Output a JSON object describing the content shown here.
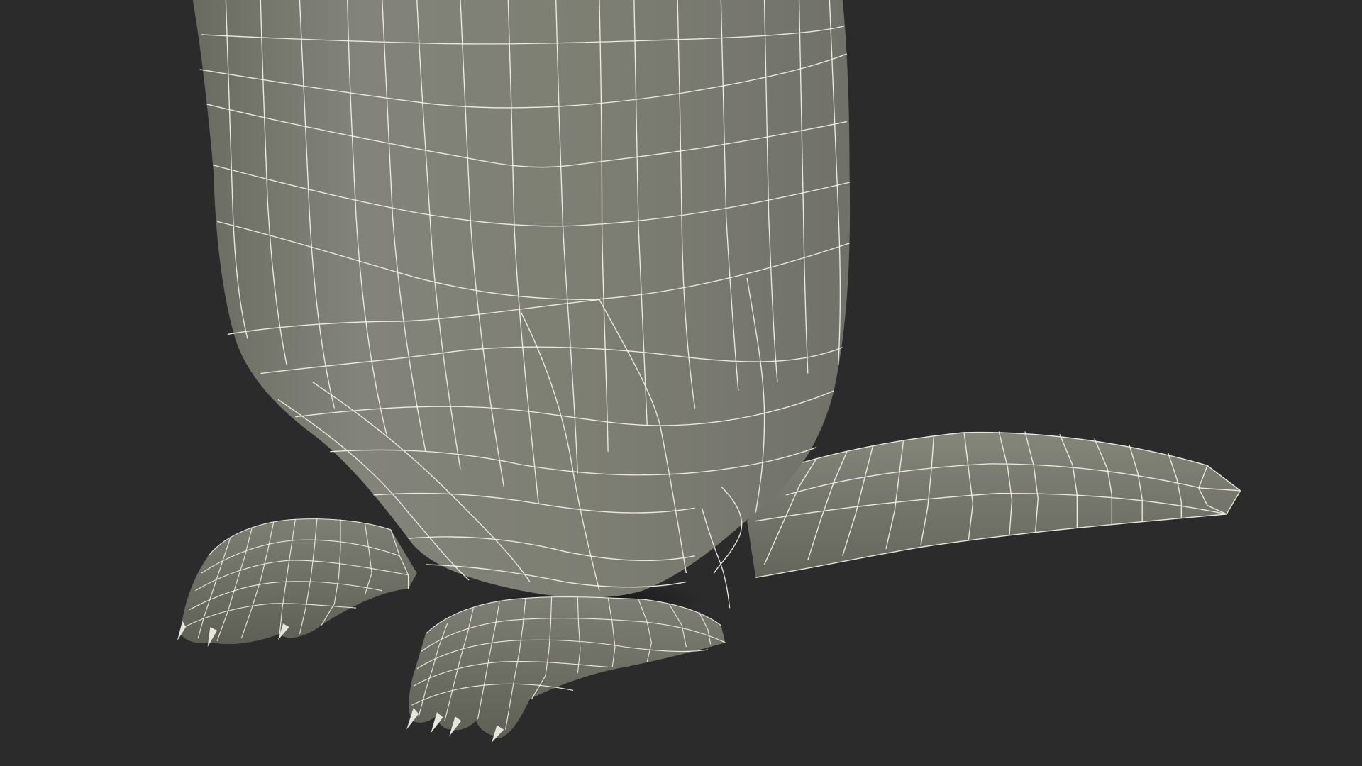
{
  "scene": {
    "subject": "wireframe-creature-model",
    "colors": {
      "background": "#2b2b2b",
      "body_fill": "#7c7d70",
      "body_light": "#8a8b7e",
      "body_dark": "#5f6055",
      "shadow": "#1a1a1a",
      "wire": "#f2f2e8"
    }
  }
}
